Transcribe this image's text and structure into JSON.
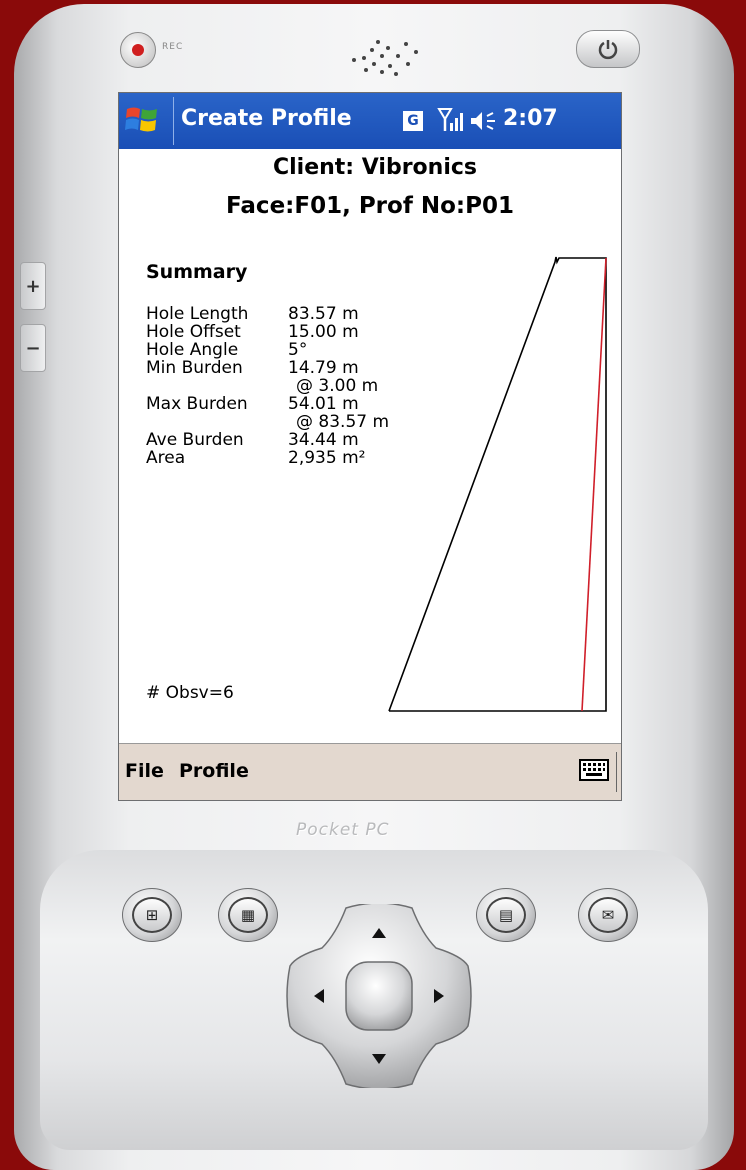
{
  "device": {
    "rec_label": "REC",
    "brand": "Pocket PC"
  },
  "status_bar": {
    "app_title": "Create Profile",
    "badge": "G",
    "time": "2:07"
  },
  "header": {
    "client": "Client: Vibronics",
    "face": "Face:F01, Prof No:P01"
  },
  "summary": {
    "title": "Summary",
    "rows": [
      {
        "label": "Hole Length",
        "value": "83.57 m"
      },
      {
        "label": "Hole Offset",
        "value": "15.00 m"
      },
      {
        "label": "Hole Angle",
        "value": "5°"
      },
      {
        "label": "Min Burden",
        "value": "14.79 m"
      },
      {
        "label": "",
        "value": "@ 3.00 m"
      },
      {
        "label": "Max Burden",
        "value": "54.01 m"
      },
      {
        "label": "",
        "value": "@ 83.57 m"
      },
      {
        "label": "Ave Burden",
        "value": "34.44 m"
      },
      {
        "label": "Area",
        "value": "2,935 m²"
      }
    ],
    "observations": "# Obsv=6"
  },
  "menu": {
    "file": "File",
    "profile": "Profile"
  },
  "colors": {
    "title_bar": "#1a4fb6",
    "menu_bar": "#e3d8cf",
    "hole_line": "#d01f2a",
    "face_line": "#000000"
  }
}
